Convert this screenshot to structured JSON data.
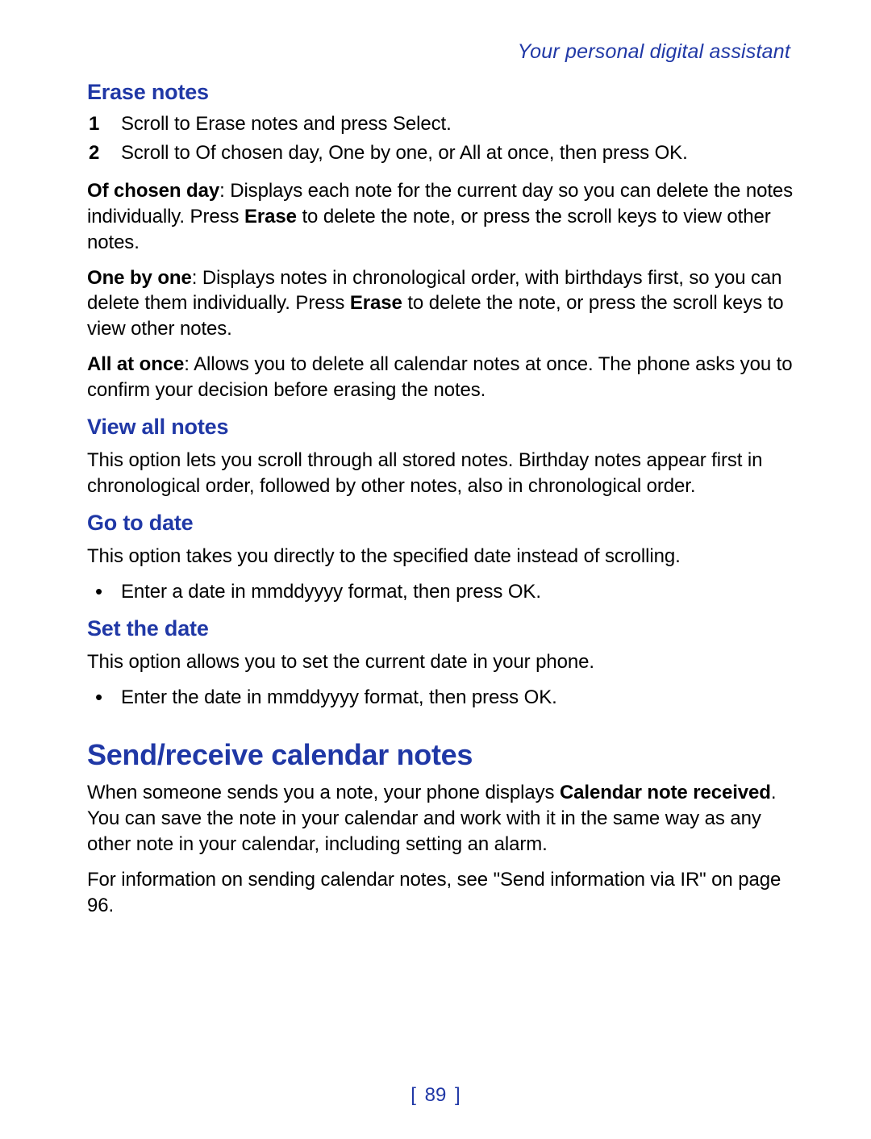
{
  "header": "Your personal digital assistant",
  "sections": {
    "erase": {
      "title": "Erase notes",
      "steps": [
        {
          "n": "1",
          "pre": "Scroll to ",
          "b1": "Erase notes",
          "mid": " and press ",
          "b2": "Select",
          "post": "."
        },
        {
          "n": "2",
          "pre": "Scroll to ",
          "b1": "Of chosen day",
          "c1": ", ",
          "b2": "One by one",
          "c2": ", or ",
          "b3": "All at once",
          "c3": ", then press ",
          "b4": "OK",
          "post": "."
        }
      ],
      "p1": {
        "b1": "Of chosen day",
        "t1": ": Displays each note for the current day so you can delete the notes individually. Press ",
        "b2": "Erase",
        "t2": " to delete the note, or press the scroll keys to view other notes."
      },
      "p2": {
        "b1": "One by one",
        "t1": ": Displays notes in chronological order, with birthdays first, so you can delete them individually. Press ",
        "b2": "Erase",
        "t2": " to delete the note, or press the scroll keys to view other notes."
      },
      "p3": {
        "b1": "All at once",
        "t1": ": Allows you to delete all calendar notes at once. The phone asks you to confirm your decision before erasing the notes."
      }
    },
    "viewall": {
      "title": "View all notes",
      "p": "This option lets you scroll through all stored notes. Birthday notes appear first in chronological order, followed by other notes, also in chronological order."
    },
    "gotodate": {
      "title": "Go to date",
      "p": "This option takes you directly to the specified date instead of scrolling.",
      "bullet": {
        "t1": "Enter a date in ",
        "b1": "mmddyyyy",
        "t2": " format, then press ",
        "b2": "OK",
        "t3": "."
      }
    },
    "setdate": {
      "title": "Set the date",
      "p": "This option allows you to set the current date in your phone.",
      "bullet": {
        "t1": "Enter the date in ",
        "b1": "mmddyyyy",
        "t2": " format, then press ",
        "b2": "OK",
        "t3": "."
      }
    },
    "sendreceive": {
      "title": "Send/receive calendar notes",
      "p1": {
        "t1": "When someone sends you a note, your phone displays ",
        "b1": "Calendar note received",
        "t2": ". You can save the note in your calendar and work with it in the same way as any other note in your calendar, including setting an alarm."
      },
      "p2": "For information on sending calendar notes, see \"Send information via IR\" on page 96."
    }
  },
  "page_number": "89"
}
